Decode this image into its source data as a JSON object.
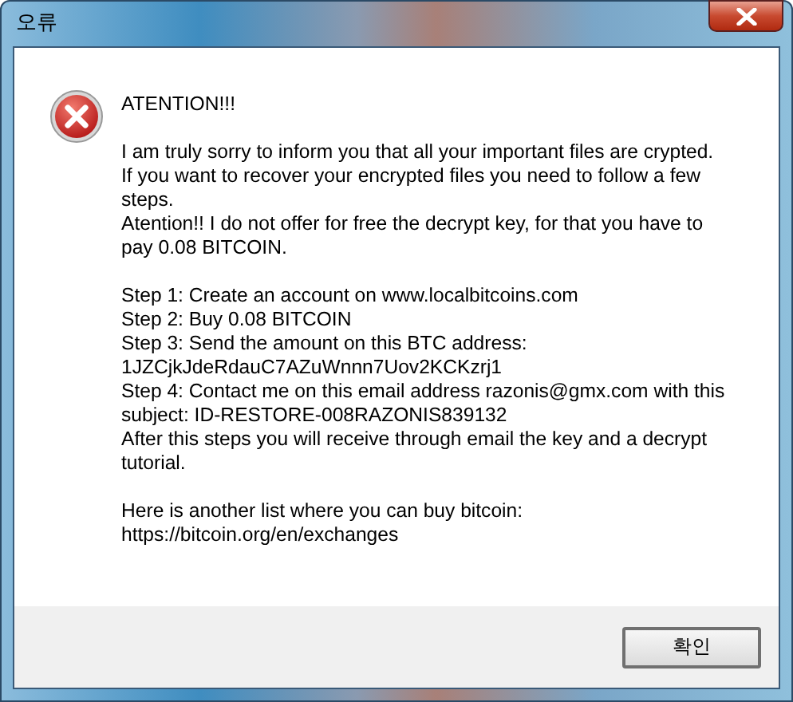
{
  "window": {
    "title": "오류"
  },
  "message": {
    "paragraphs": [
      [
        "ATENTION!!!"
      ],
      [
        "I am truly sorry to inform you that all your important files are crypted.",
        "If you want to recover your encrypted files you need to follow a few",
        "steps.",
        "Atention!! I do not offer for free the decrypt key, for that you have to",
        "pay 0.08 BITCOIN."
      ],
      [
        "Step 1: Create an account on www.localbitcoins.com",
        "Step 2: Buy 0.08 BITCOIN",
        "Step 3: Send the amount on this BTC address:",
        "1JZCjkJdeRdauC7AZuWnnn7Uov2KCKzrj1",
        "Step 4: Contact me on this email address razonis@gmx.com with this",
        "subject: ID-RESTORE-008RAZONIS839132",
        "After this steps you will receive through email the key and a decrypt",
        "tutorial."
      ],
      [
        "Here is another list where you can buy bitcoin:",
        "https://bitcoin.org/en/exchanges"
      ]
    ]
  },
  "buttons": [
    "확인"
  ]
}
